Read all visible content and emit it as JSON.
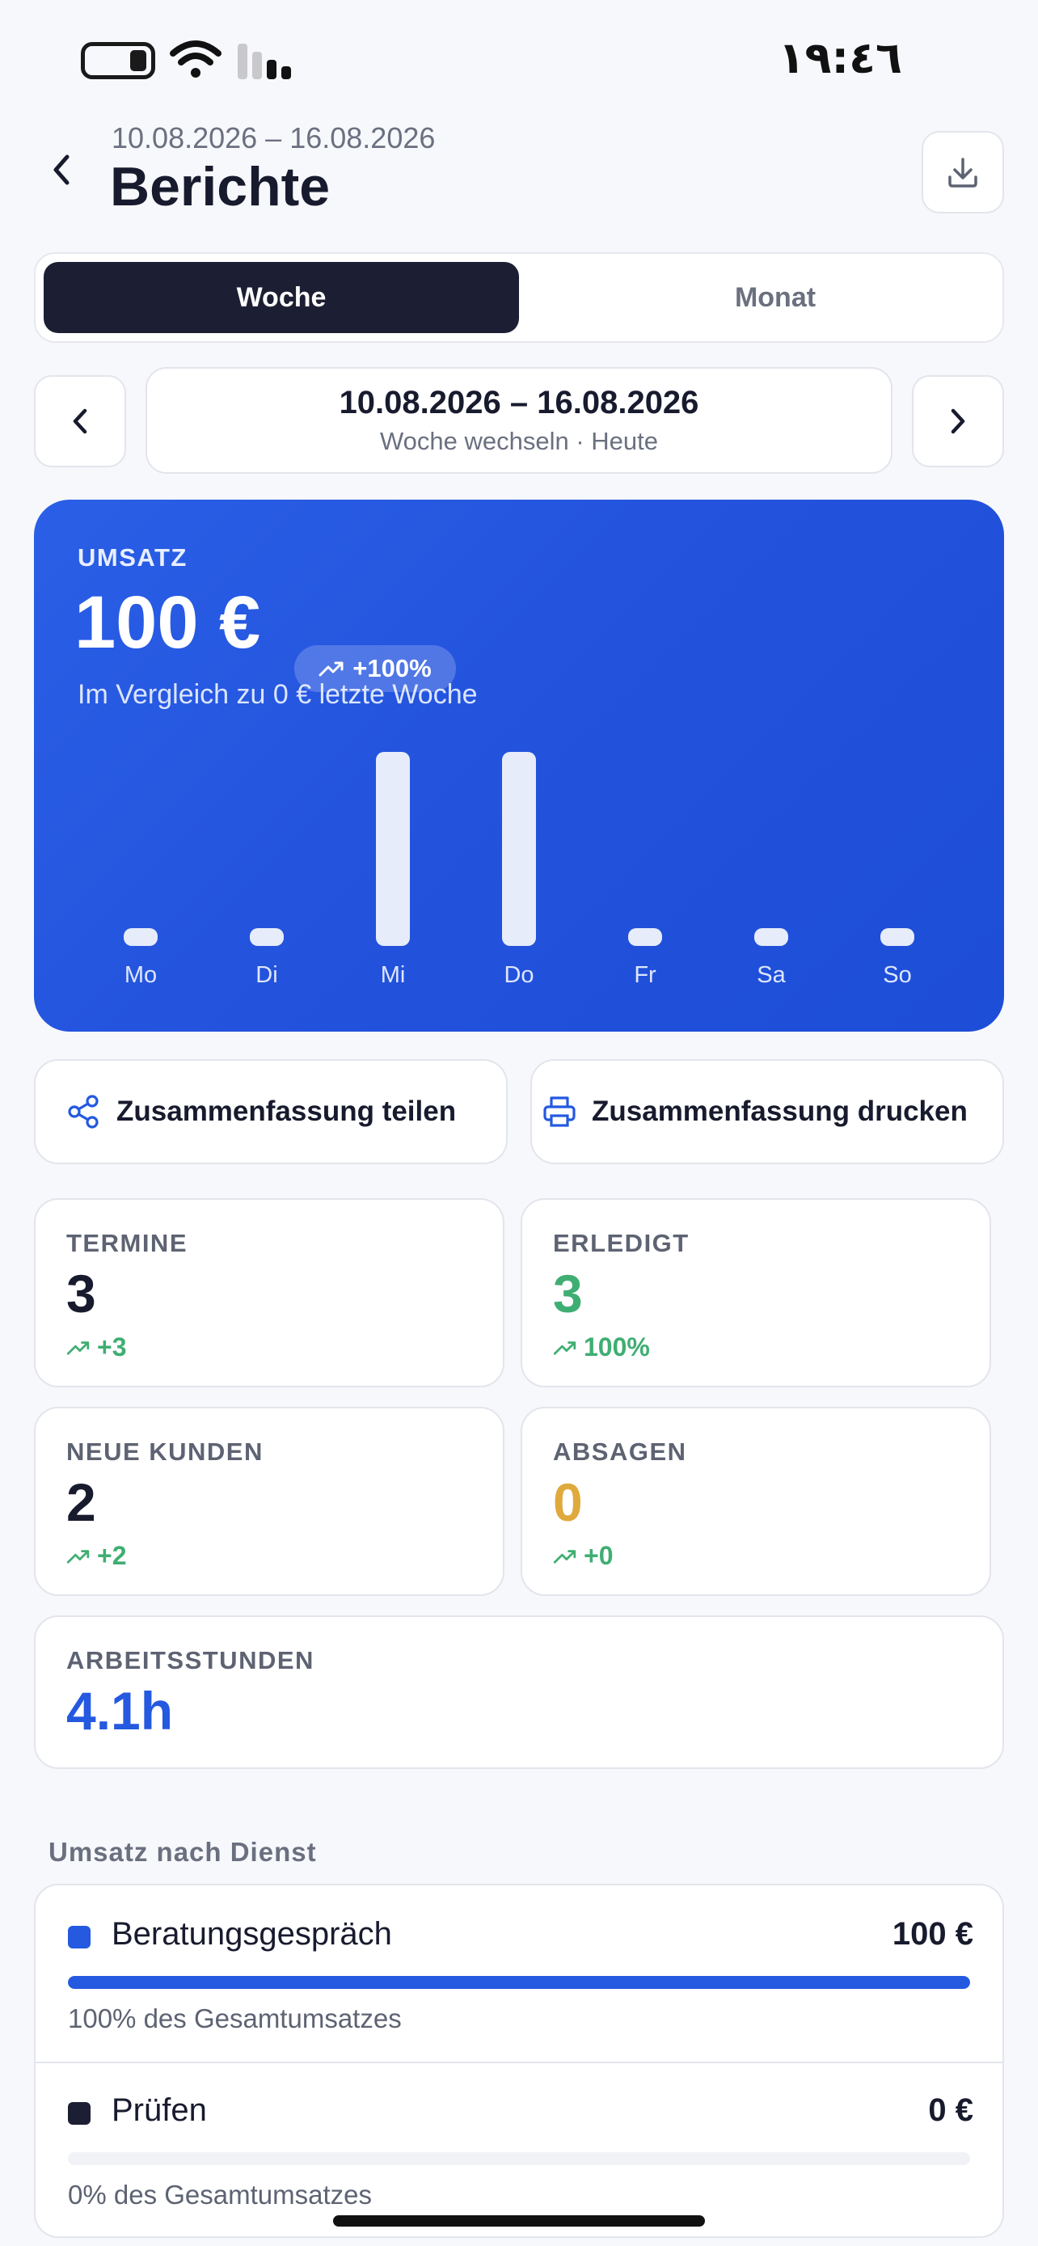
{
  "status_bar": {
    "time": "١٩:٤٦"
  },
  "header": {
    "subtitle": "10.08.2026 – 16.08.2026",
    "title": "Berichte"
  },
  "period_toggle": {
    "week": "Woche",
    "month": "Monat",
    "selected": "Woche"
  },
  "week_nav": {
    "range": "10.08.2026 – 16.08.2026",
    "hint": "Woche wechseln · Heute"
  },
  "revenue": {
    "label": "UMSATZ",
    "value": "100 €",
    "change": "+100%",
    "comparison": "Im Vergleich zu 0 € letzte Woche"
  },
  "chart_data": {
    "type": "bar",
    "categories": [
      "Mo",
      "Di",
      "Mi",
      "Do",
      "Fr",
      "Sa",
      "So"
    ],
    "values": [
      0,
      0,
      50,
      50,
      0,
      0,
      0
    ]
  },
  "actions": {
    "share": "Zusammenfassung teilen",
    "print": "Zusammenfassung drucken"
  },
  "stats": {
    "appointments": {
      "label": "TERMINE",
      "value": "3",
      "delta": "+3"
    },
    "completed": {
      "label": "ERLEDIGT",
      "value": "3",
      "delta": "100%"
    },
    "new_customers": {
      "label": "NEUE KUNDEN",
      "value": "2",
      "delta": "+2"
    },
    "cancellations": {
      "label": "ABSAGEN",
      "value": "0",
      "delta": "+0"
    },
    "work_hours": {
      "label": "ARBEITSSTUNDEN",
      "value": "4.1h"
    }
  },
  "services": {
    "title": "Umsatz nach Dienst",
    "items": [
      {
        "name": "Beratungsgespräch",
        "amount": "100 €",
        "share": 1.0,
        "share_text": "100% des Gesamtumsatzes",
        "color": "#2459e0"
      },
      {
        "name": "Prüfen",
        "amount": "0 €",
        "share": 0.0,
        "share_text": "0% des Gesamtumsatzes",
        "color": "#1c1f33"
      }
    ]
  },
  "colors": {
    "accent": "#2459e0",
    "dark": "#1c1f33",
    "positive": "#3fae72",
    "warning": "#e0a93c"
  }
}
